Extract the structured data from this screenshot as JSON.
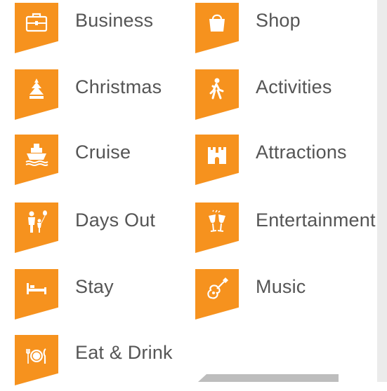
{
  "categories": [
    {
      "label": "Business",
      "icon": "briefcase-icon"
    },
    {
      "label": "Shop",
      "icon": "shopping-bag-icon"
    },
    {
      "label": "Christmas",
      "icon": "christmas-tree-icon"
    },
    {
      "label": "Activities",
      "icon": "hiking-person-icon"
    },
    {
      "label": "Cruise",
      "icon": "cruise-ship-icon"
    },
    {
      "label": "Attractions",
      "icon": "castle-icon"
    },
    {
      "label": "Days Out",
      "icon": "family-balloon-icon"
    },
    {
      "label": "Entertainment",
      "icon": "cheers-glasses-icon"
    },
    {
      "label": "Stay",
      "icon": "bed-icon"
    },
    {
      "label": "Music",
      "icon": "guitar-icon"
    },
    {
      "label": "Eat & Drink",
      "icon": "plate-cutlery-icon"
    }
  ],
  "colors": {
    "accent": "#f6921e",
    "text": "#555555"
  }
}
